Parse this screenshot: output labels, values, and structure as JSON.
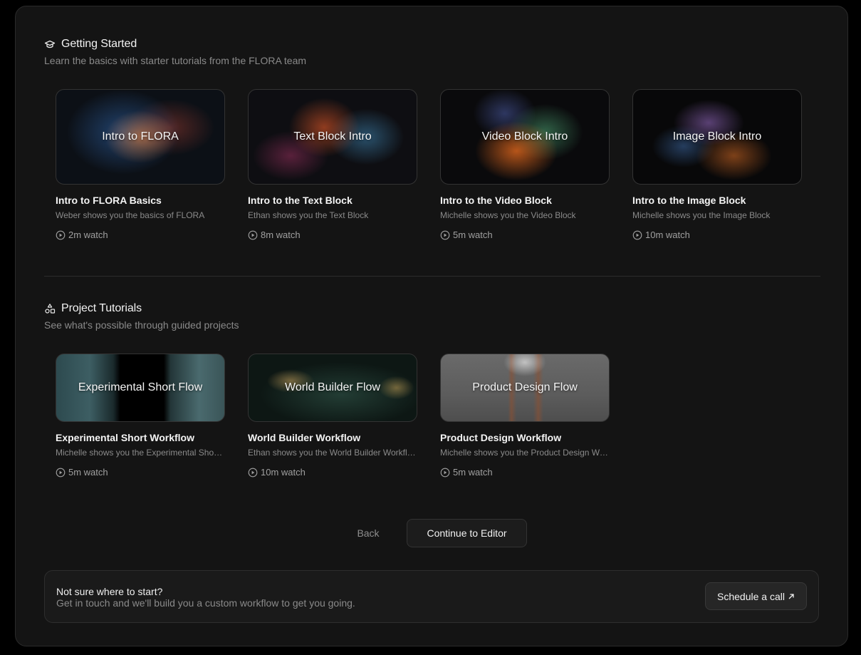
{
  "getting_started": {
    "title": "Getting Started",
    "subtitle": "Learn the basics with starter tutorials from the FLORA team",
    "icon": "graduation-cap-icon",
    "cards": [
      {
        "thumb_label": "Intro to FLORA",
        "title": "Intro to FLORA Basics",
        "desc": "Weber shows you the basics of FLORA",
        "duration": "2m watch"
      },
      {
        "thumb_label": "Text Block Intro",
        "title": "Intro to the Text Block",
        "desc": "Ethan shows you the Text Block",
        "duration": "8m watch"
      },
      {
        "thumb_label": "Video Block Intro",
        "title": "Intro to the Video Block",
        "desc": "Michelle shows you the Video Block",
        "duration": "5m watch"
      },
      {
        "thumb_label": "Image Block Intro",
        "title": "Intro to the Image Block",
        "desc": "Michelle shows you the Image Block",
        "duration": "10m watch"
      }
    ]
  },
  "project_tutorials": {
    "title": "Project Tutorials",
    "subtitle": "See what's possible through guided projects",
    "icon": "shapes-icon",
    "cards": [
      {
        "thumb_label": "Experimental Short Flow",
        "title": "Experimental Short Workflow",
        "desc": "Michelle shows you the Experimental Short Workflow",
        "duration": "5m watch"
      },
      {
        "thumb_label": "World Builder Flow",
        "title": "World Builder Workflow",
        "desc": "Ethan shows you the World Builder Workflow",
        "duration": "10m watch"
      },
      {
        "thumb_label": "Product Design Flow",
        "title": "Product Design Workflow",
        "desc": "Michelle shows you the Product Design Workflow",
        "duration": "5m watch"
      }
    ]
  },
  "actions": {
    "back_label": "Back",
    "continue_label": "Continue to Editor"
  },
  "help": {
    "title": "Not sure where to start?",
    "subtitle": "Get in touch and we'll build you a custom workflow to get you going.",
    "schedule_label": "Schedule a call",
    "schedule_icon": "arrow-up-right-icon"
  }
}
